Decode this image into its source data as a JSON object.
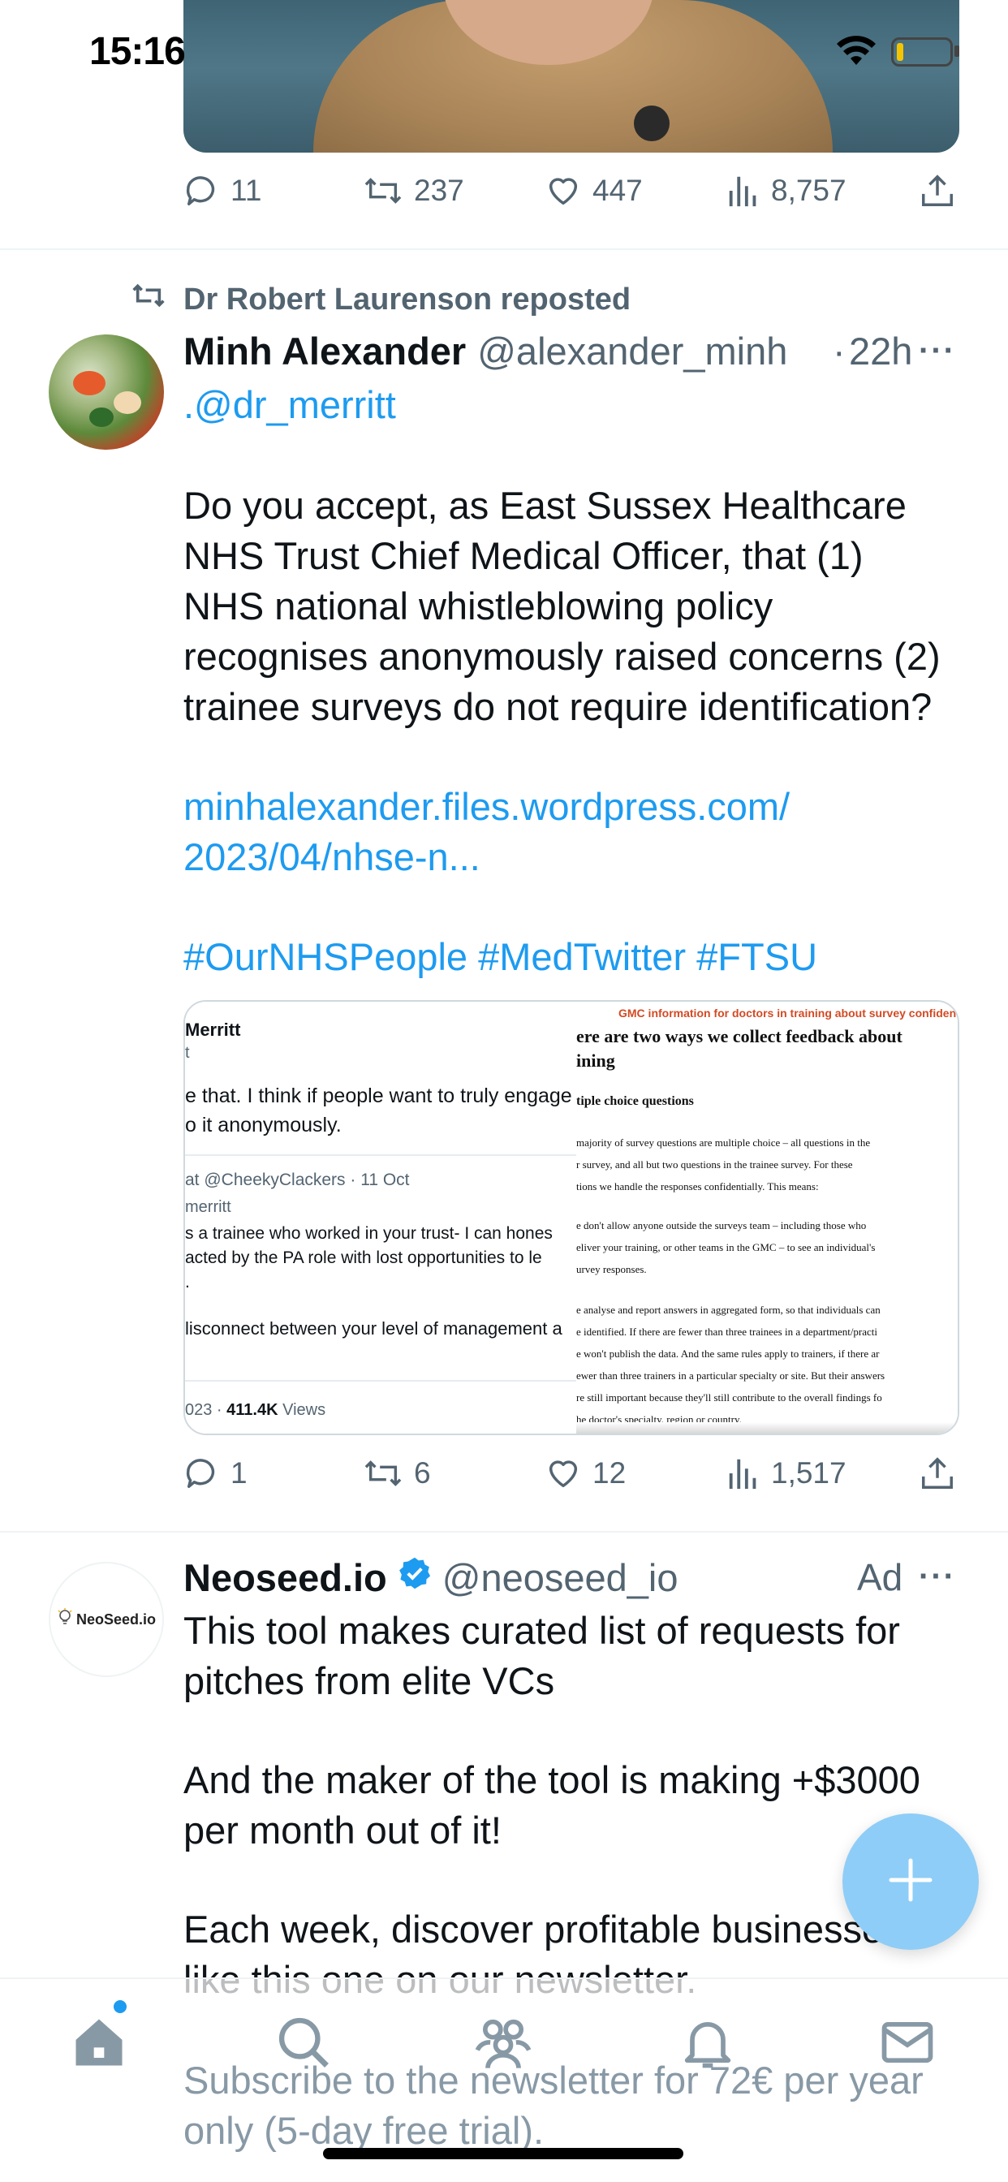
{
  "status_bar": {
    "time": "15:16"
  },
  "top_tweet": {
    "actions": {
      "replies": "11",
      "reposts": "237",
      "likes": "447",
      "views": "8,757"
    }
  },
  "tweet": {
    "repost_by": "Dr Robert Laurenson reposted",
    "author_name": "Minh Alexander",
    "author_handle": "@alexander_minh",
    "separator": "·",
    "time": "22h",
    "more": "···",
    "mention": ".@dr_merritt",
    "body_lines": [
      "Do you accept, as East Sussex Healthcare",
      "NHS Trust Chief Medical Officer, that (1)",
      "NHS national whistleblowing policy",
      "recognises anonymously raised concerns (2)",
      "trainee surveys do not require identification?"
    ],
    "link_lines": [
      "minhalexander.files.wordpress.com/",
      "2023/04/nhse-n..."
    ],
    "hashtags": "#OurNHSPeople #MedTwitter #FTSU",
    "attachment": {
      "left": {
        "name": "Merritt",
        "sub": "t",
        "text1": "e that. I think if people want to truly engage",
        "text2": "o it anonymously.",
        "reply_meta": "at @CheekyClackers · 11 Oct",
        "reply_to": "merritt",
        "reply1": "s a trainee who worked in your trust- I can hones",
        "reply2": "acted by the PA role with lost opportunities to le",
        "reply3": ".",
        "reply4": "lisconnect between your level of management a",
        "footer_date": "023 · ",
        "footer_views": "411.4K",
        "footer_label": " Views"
      },
      "right": {
        "banner": "GMC information for doctors in training about survey confiden",
        "heading1": "ere are two ways we collect feedback about",
        "heading2": "ining",
        "subheading": "tiple choice questions",
        "p1": [
          "majority of survey questions are multiple choice – all questions in the",
          "r survey, and all but two questions in the trainee survey. For these",
          "tions we handle the responses confidentially. This means:"
        ],
        "p2": [
          "e don't allow anyone outside the surveys team – including those who",
          "eliver your training, or other teams in the GMC – to see an individual's",
          "urvey responses."
        ],
        "p3": [
          "e analyse and report answers in aggregated form, so that individuals can",
          "e identified. If there are fewer than three trainees in a department/practi",
          "e won't publish the data. And the same rules apply to trainers, if there ar",
          "ewer than three trainers in a particular specialty or site. But their answers",
          "re still important because they'll still contribute to the overall findings fo",
          "he doctor's specialty, region or country."
        ]
      }
    },
    "actions": {
      "replies": "1",
      "reposts": "6",
      "likes": "12",
      "views": "1,517"
    }
  },
  "ad": {
    "avatar_text": "NeoSeed.io",
    "author_name": "Neoseed.io",
    "author_handle": "@neoseed_io",
    "ad_label": "Ad",
    "more": "···",
    "lines": [
      "This tool makes curated list of requests for",
      "pitches from elite VCs",
      "And the maker of the tool is making +$3000",
      "per month out of it!",
      "Each week, discover profitable businesses",
      "like this one on our newsletter.",
      "Subscribe to the newsletter for 72€ per year",
      "only (5-day free trial)."
    ]
  },
  "colors": {
    "accent": "#1d9bf0",
    "muted": "#536471",
    "fab": "#8ecdf7"
  },
  "icons": {
    "reply": "reply-icon",
    "repost": "repost-icon",
    "like": "heart-icon",
    "views": "views-icon",
    "share": "share-icon",
    "nav": [
      "home-icon",
      "search-icon",
      "communities-icon",
      "notifications-icon",
      "messages-icon"
    ]
  }
}
